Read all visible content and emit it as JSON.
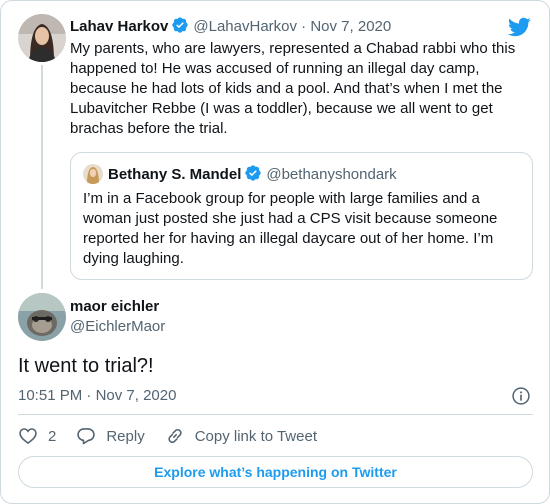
{
  "colors": {
    "accent": "#1d9bf0",
    "text": "#0f1419",
    "secondary": "#536471",
    "border": "#cfd9de"
  },
  "reply_to": {
    "author_name": "Lahav Harkov",
    "author_handle": "@LahavHarkov",
    "separator": "·",
    "date": "Nov 7, 2020",
    "verified_icon": "verified-badge-icon",
    "text": "My parents, who are lawyers, represented a Chabad rabbi who this happened to! He was accused of running an illegal day camp, because he had lots of kids and a pool. And that’s when I met the Lubavitcher Rebbe (I was a toddler), because we all went to get brachas before the trial."
  },
  "quoted": {
    "author_name": "Bethany S. Mandel",
    "author_handle": "@bethanyshondark",
    "text": "I’m in a Facebook group for people with large families and a woman just posted she just had a CPS visit because someone reported her for having an illegal daycare out of her home. I’m dying laughing."
  },
  "tweet": {
    "author_name": "maor eichler",
    "author_handle": "@EichlerMaor",
    "text": "It went to trial?!",
    "time": "10:51 PM",
    "separator": "·",
    "date": "Nov 7, 2020"
  },
  "actions": {
    "like_count": "2",
    "reply_label": "Reply",
    "copy_label": "Copy link to Tweet"
  },
  "explore_label": "Explore what’s happening on Twitter",
  "icons": [
    "twitter-bird-icon",
    "info-icon",
    "heart-icon",
    "reply-icon",
    "link-icon"
  ]
}
